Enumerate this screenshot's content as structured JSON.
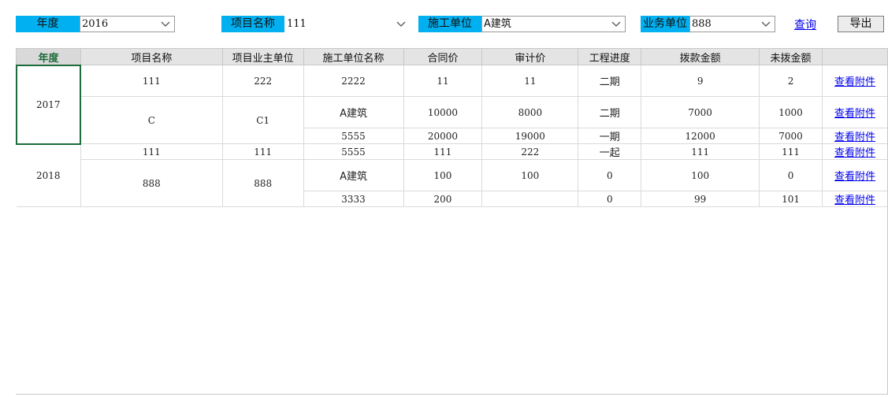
{
  "filters": {
    "year": {
      "label": "年度",
      "value": "2016"
    },
    "project": {
      "label": "项目名称",
      "value": "111"
    },
    "contractor": {
      "label": "施工单位",
      "value": "A建筑"
    },
    "business_unit": {
      "label": "业务单位",
      "value": "888"
    }
  },
  "actions": {
    "query": "查询",
    "export": "导出"
  },
  "table": {
    "headers": [
      "年度",
      "项目名称",
      "项目业主单位",
      "施工单位名称",
      "合同价",
      "审计价",
      "工程进度",
      "拨款金额",
      "未拨金额",
      ""
    ],
    "rows": [
      {
        "year": "2017",
        "project": "111",
        "owner": "222",
        "contractor": "2222",
        "contract": "11",
        "audit": "11",
        "progress": "二期",
        "paid": "9",
        "unpaid": "2",
        "link": "查看附件"
      },
      {
        "project": "C",
        "owner": "C1",
        "contractor": "A建筑",
        "contract": "10000",
        "audit": "8000",
        "progress": "二期",
        "paid": "7000",
        "unpaid": "1000",
        "link": "查看附件"
      },
      {
        "contractor": "5555",
        "contract": "20000",
        "audit": "19000",
        "progress": "一期",
        "paid": "12000",
        "unpaid": "7000",
        "link": "查看附件"
      },
      {
        "year": "2018",
        "project": "111",
        "owner": "111",
        "contractor": "5555",
        "contract": "111",
        "audit": "222",
        "progress": "一起",
        "paid": "111",
        "unpaid": "111",
        "link": "查看附件"
      },
      {
        "project": "888",
        "owner": "888",
        "contractor": "A建筑",
        "contract": "100",
        "audit": "100",
        "progress": "0",
        "paid": "100",
        "unpaid": "0",
        "link": "查看附件"
      },
      {
        "contractor": "3333",
        "contract": "200",
        "audit": "",
        "progress": "0",
        "paid": "99",
        "unpaid": "101",
        "link": "查看附件"
      }
    ]
  }
}
